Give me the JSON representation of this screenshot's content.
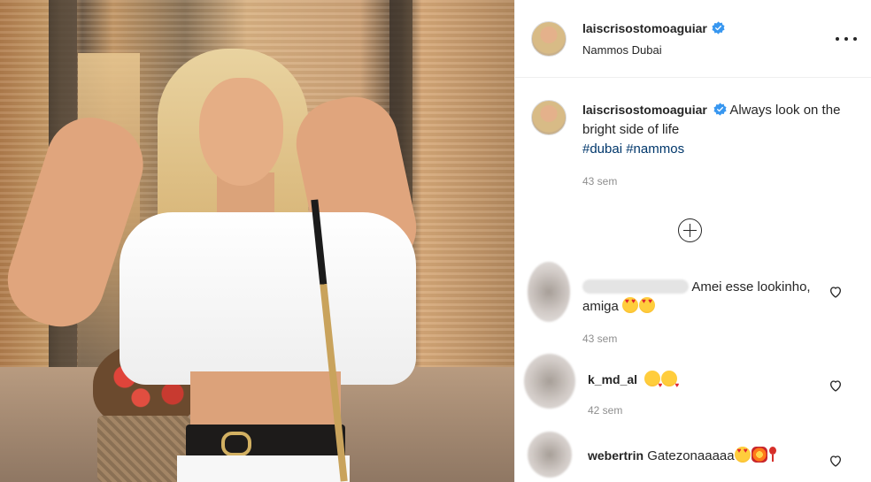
{
  "post": {
    "photo_alt": "",
    "header": {
      "username": "laiscrisostomoaguiar",
      "verified": true,
      "location": "Nammos Dubai",
      "more_icon": "more-options-icon"
    },
    "caption": {
      "username": "laiscrisostomoaguiar",
      "text": "Always look on the bright side of life",
      "hashtags": [
        "#dubai",
        "#nammos"
      ],
      "time": "43 sem"
    },
    "load_more_icon": "plus-circle-icon",
    "comments": [
      {
        "username": "",
        "text": "Amei esse lookinho, amiga",
        "emojis": [
          "heart-eyes",
          "heart-eyes"
        ],
        "time": "43 sem"
      },
      {
        "username": "k_md_al",
        "text": "",
        "emojis": [
          "kiss",
          "kiss"
        ],
        "time": "42 sem"
      },
      {
        "username": "webertrin",
        "text": "Gatezonaaaaa",
        "emojis": [
          "heart-eyes",
          "collision",
          "exclamation"
        ],
        "time": ""
      }
    ],
    "colors": {
      "text": "#262626",
      "secondary": "#8e8e8e",
      "hashtag": "#00376b",
      "verified": "#3897f0",
      "border": "#efefef"
    }
  }
}
